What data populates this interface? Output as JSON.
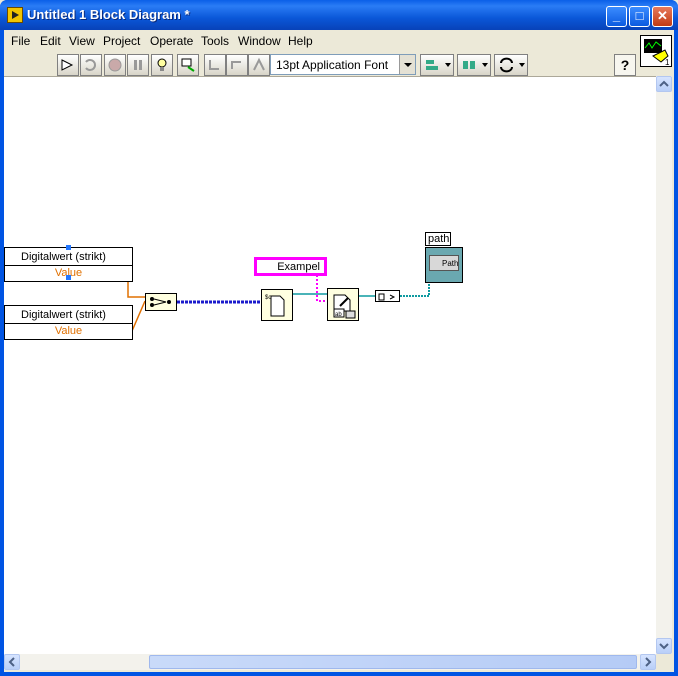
{
  "window": {
    "title": "Untitled 1 Block Diagram *"
  },
  "title_buttons": {
    "minimize": "_",
    "maximize": "□",
    "close": "✕"
  },
  "menu": [
    {
      "label": "File",
      "mnemonic": "F"
    },
    {
      "label": "Edit",
      "mnemonic": "E"
    },
    {
      "label": "View",
      "mnemonic": "V"
    },
    {
      "label": "Project",
      "mnemonic": "P"
    },
    {
      "label": "Operate",
      "mnemonic": "O"
    },
    {
      "label": "Tools",
      "mnemonic": "T"
    },
    {
      "label": "Window",
      "mnemonic": "W"
    },
    {
      "label": "Help",
      "mnemonic": "H"
    }
  ],
  "toolbar": {
    "font_select": "13pt Application Font",
    "help_label": "?",
    "vi_icon_number": "1"
  },
  "diagram": {
    "digital_nodes": [
      {
        "name": "Digitalwert (strikt)",
        "value_label": "Value"
      },
      {
        "name": "Digitalwert (strikt)",
        "value_label": "Value"
      }
    ],
    "string_constant": "Exampel",
    "path_indicator": {
      "label": "path",
      "text": "Path"
    }
  },
  "colors": {
    "dig_value": "#e07000",
    "wire_blue": "#1a1acc",
    "wire_teal": "#0e9aa0",
    "wire_pink": "#ff00ff",
    "wire_orange": "#e07000"
  }
}
